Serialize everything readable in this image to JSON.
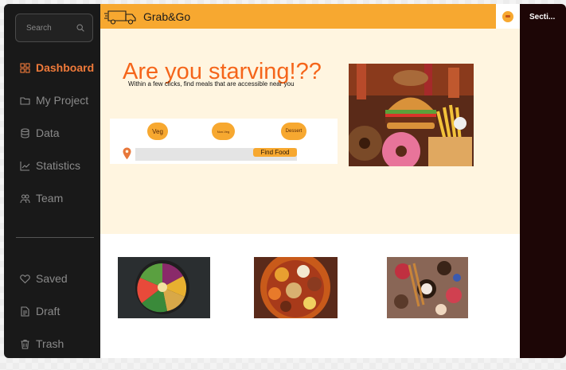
{
  "sidebar": {
    "search_placeholder": "Search",
    "nav_items": [
      {
        "label": "Dashboard",
        "icon": "grid-icon",
        "active": true
      },
      {
        "label": "My Project",
        "icon": "folder-icon"
      },
      {
        "label": "Data",
        "icon": "database-icon"
      },
      {
        "label": "Statistics",
        "icon": "chart-icon"
      },
      {
        "label": "Team",
        "icon": "team-icon"
      }
    ],
    "bottom_items": [
      {
        "label": "Saved",
        "icon": "heart-icon"
      },
      {
        "label": "Draft",
        "icon": "draft-icon"
      },
      {
        "label": "Trash",
        "icon": "trash-icon"
      }
    ]
  },
  "topbar": {
    "brand": "Grab&Go",
    "logo_icon": "delivery-truck-icon",
    "avatar_icon": "food-avatar-icon"
  },
  "hero": {
    "title": "Are you starving!??",
    "subtitle": "Within a few clicks, find meals that are accessible near you",
    "chips": [
      "Veg",
      "Non-Veg",
      "Dessert"
    ],
    "location_placeholder": "",
    "find_button": "Find Food",
    "image": "burger-and-fast-food-photo"
  },
  "gallery": [
    {
      "image": "vegetable-bowl-photo"
    },
    {
      "image": "indian-thali-photo"
    },
    {
      "image": "dessert-platter-photo"
    }
  ],
  "right_panel": {
    "label": "Secti..."
  },
  "colors": {
    "accent_orange": "#f7a830",
    "title_orange": "#f5651a",
    "sidebar_bg": "#191919",
    "hero_bg": "#fff5e0"
  }
}
